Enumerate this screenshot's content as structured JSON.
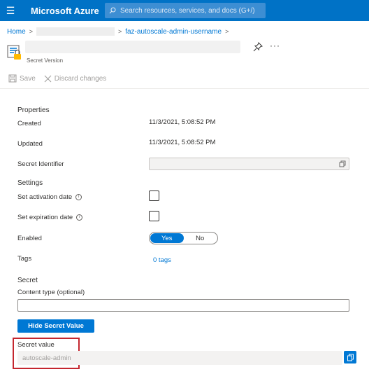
{
  "topbar": {
    "brand": "Microsoft Azure",
    "search_placeholder": "Search resources, services, and docs (G+/)"
  },
  "breadcrumb": {
    "home": "Home",
    "current": "faz-autoscale-admin-username"
  },
  "header": {
    "subtitle": "Secret Version"
  },
  "toolbar": {
    "save": "Save",
    "discard": "Discard changes"
  },
  "properties": {
    "heading": "Properties",
    "created_label": "Created",
    "created_value": "11/3/2021, 5:08:52 PM",
    "updated_label": "Updated",
    "updated_value": "11/3/2021, 5:08:52 PM",
    "identifier_label": "Secret Identifier"
  },
  "settings": {
    "heading": "Settings",
    "activation_label": "Set activation date",
    "expiration_label": "Set expiration date",
    "enabled_label": "Enabled",
    "enabled_yes": "Yes",
    "enabled_no": "No",
    "enabled_selected": "Yes",
    "tags_label": "Tags",
    "tags_value": "0 tags"
  },
  "secret": {
    "heading": "Secret",
    "content_type_label": "Content type (optional)",
    "content_type_value": "",
    "hide_button": "Hide Secret Value",
    "value_label": "Secret value",
    "value": "autoscale-admin"
  },
  "colors": {
    "azure_blue": "#0072c6",
    "accent": "#0078d4",
    "highlight_red": "#c4262e"
  }
}
